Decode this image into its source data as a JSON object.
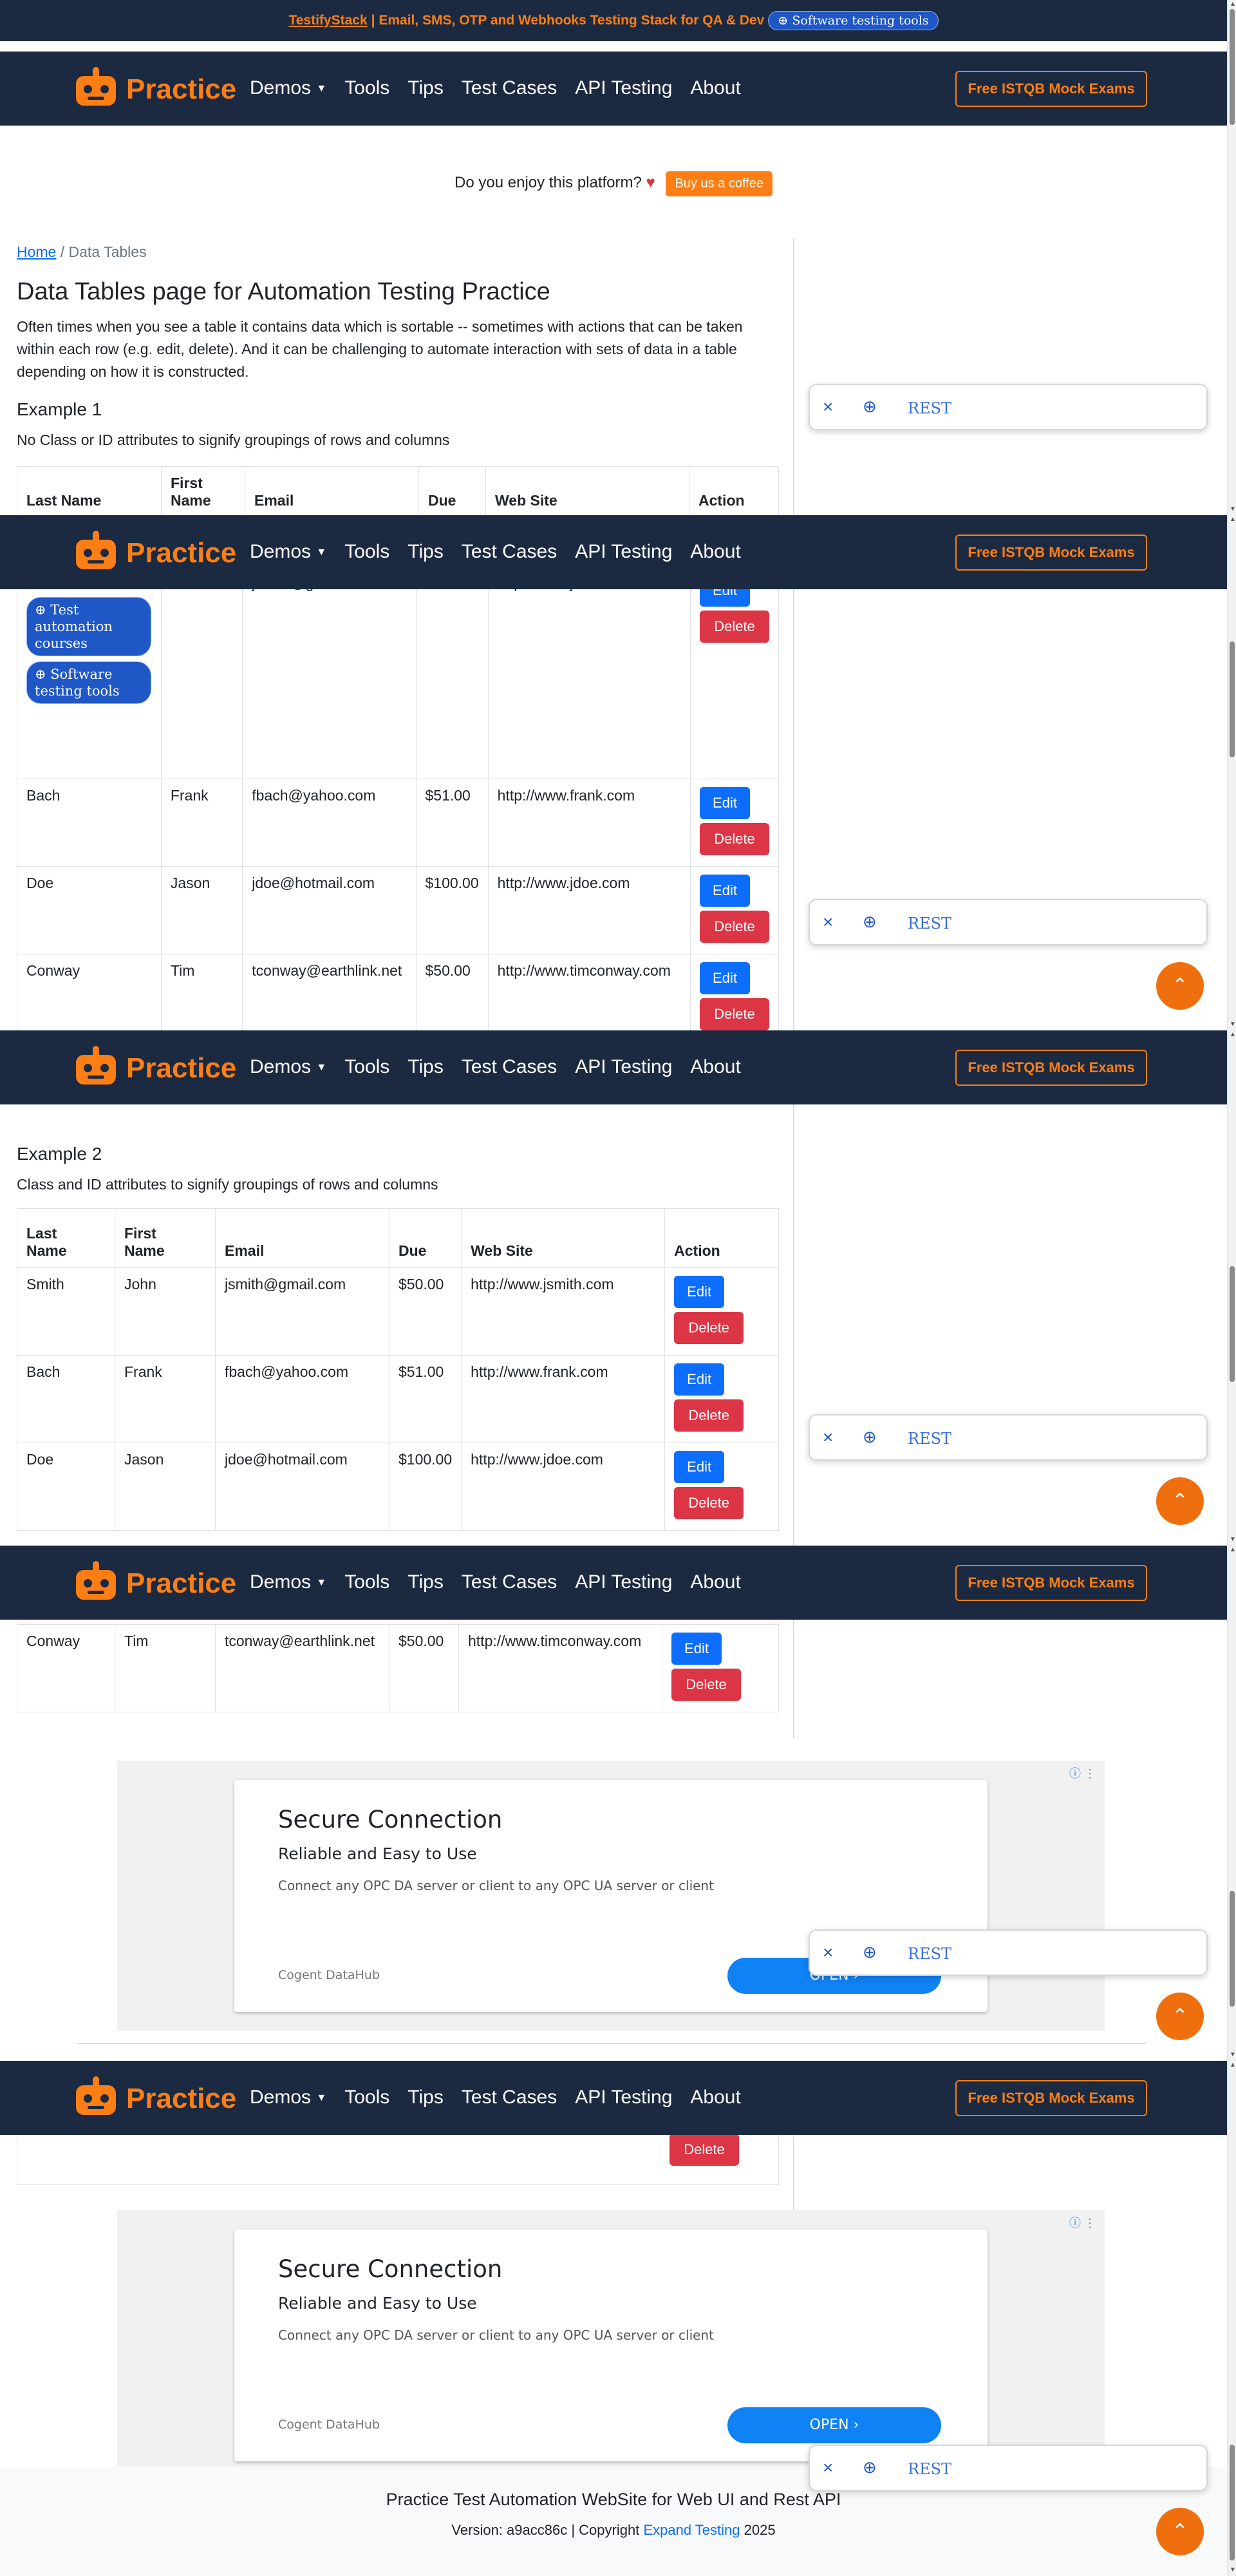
{
  "topbar": {
    "brand": "TestifyStack",
    "tagline": "| Email, SMS, OTP and Webhooks Testing Stack for QA & Dev",
    "pill": "Software testing tools"
  },
  "nav": {
    "brand": "Practice",
    "items": [
      "Demos",
      "Tools",
      "Tips",
      "Test Cases",
      "API Testing",
      "About"
    ],
    "cta": "Free ISTQB Mock Exams"
  },
  "coffee": {
    "text": "Do you enjoy this platform?",
    "button": "Buy us a coffee"
  },
  "breadcrumb": {
    "home": "Home",
    "sep": "/",
    "current": "Data Tables"
  },
  "page": {
    "title": "Data Tables page for Automation Testing Practice",
    "intro": "Often times when you see a table it contains data which is sortable -- sometimes with actions that can be taken within each row (e.g. edit, delete). And it can be challenging to automate interaction with sets of data in a table depending on how it is constructed."
  },
  "example1": {
    "title": "Example 1",
    "desc": "No Class or ID attributes to signify groupings of rows and columns"
  },
  "example2": {
    "title": "Example 2",
    "desc": "Class and ID attributes to signify groupings of rows and columns"
  },
  "table": {
    "headers": [
      "Last Name",
      "First Name",
      "Email",
      "Due",
      "Web Site",
      "Action"
    ],
    "headers_t1_top": [
      "Last Name",
      "First Name",
      "Email",
      "Due",
      "Web Site",
      "Action"
    ],
    "rows": [
      [
        "Smith",
        "John",
        "jsmith@gmail.com",
        "$50.00",
        "http://www.jsmith.com"
      ],
      [
        "Bach",
        "Frank",
        "fbach@yahoo.com",
        "$51.00",
        "http://www.frank.com"
      ],
      [
        "Doe",
        "Jason",
        "jdoe@hotmail.com",
        "$100.00",
        "http://www.jdoe.com"
      ],
      [
        "Conway",
        "Tim",
        "tconway@earthlink.net",
        "$50.00",
        "http://www.timconway.com"
      ]
    ],
    "edit": "Edit",
    "delete": "Delete"
  },
  "floating_pills": [
    "Test automation courses",
    "Software testing tools"
  ],
  "chat": {
    "label": "REST",
    "close": "×",
    "plus": "⊕"
  },
  "fab": "⌃",
  "ad": {
    "headline": "Secure Connection",
    "sub": "Reliable and Easy to Use",
    "desc": "Connect any OPC DA server or client to any OPC UA server or client",
    "source": "Cogent DataHub",
    "cta": "OPEN",
    "info": "ⓘ ⋮"
  },
  "footer": {
    "title": "Practice Test Automation WebSite for Web UI and Rest API",
    "version": "Version: a9acc86c | Copyright",
    "link": "Expand Testing",
    "year": "2025"
  }
}
